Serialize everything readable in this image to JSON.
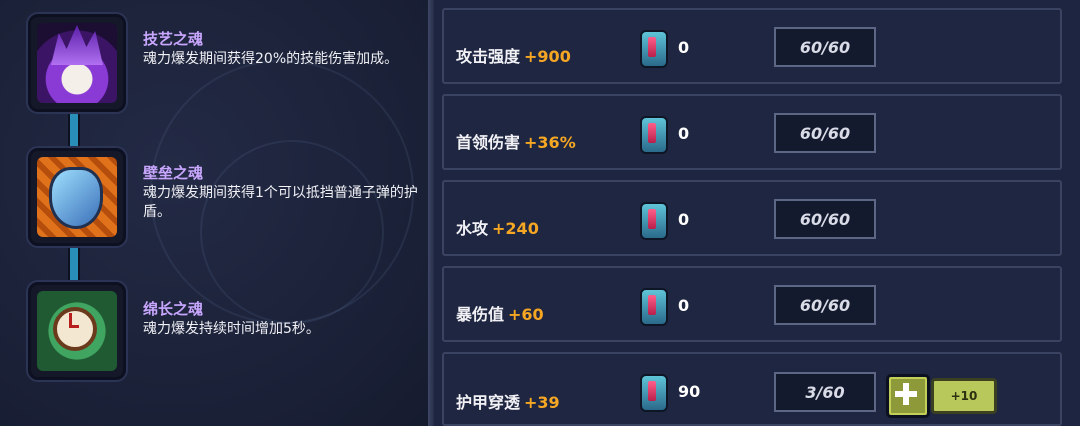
{
  "souls": [
    {
      "name": "技艺之魂",
      "desc": "魂力爆发期间获得20%的技能伤害加成。",
      "icon": "skill-soul-icon"
    },
    {
      "name": "壁垒之魂",
      "desc": "魂力爆发期间获得1个可以抵挡普通子弹的护盾。",
      "icon": "bulwark-soul-icon"
    },
    {
      "name": "绵长之魂",
      "desc": "魂力爆发持续时间增加5秒。",
      "icon": "duration-soul-icon"
    }
  ],
  "stats": [
    {
      "label": "攻击强度",
      "bonus": "+900",
      "count": "0",
      "progress": "60/60"
    },
    {
      "label": "首领伤害",
      "bonus": "+36%",
      "count": "0",
      "progress": "60/60"
    },
    {
      "label": "水攻",
      "bonus": "+240",
      "count": "0",
      "progress": "60/60"
    },
    {
      "label": "暴伤值",
      "bonus": "+60",
      "count": "0",
      "progress": "60/60"
    },
    {
      "label": "护甲穿透",
      "bonus": "+39",
      "count": "90",
      "progress": "3/60",
      "plus10_label": "+10"
    }
  ],
  "colors": {
    "soul_name": "#c9a7ff",
    "bonus": "#f5a623",
    "button": "#8e9a3a"
  }
}
